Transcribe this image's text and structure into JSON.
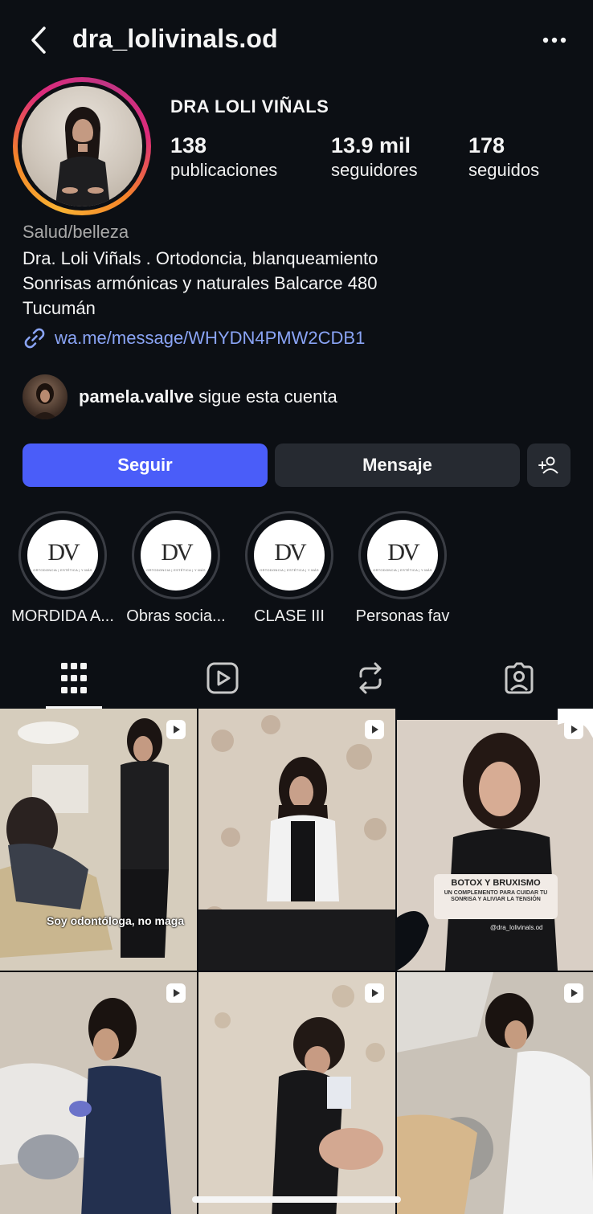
{
  "header": {
    "username": "dra_lolivinals.od",
    "back_icon": "chevron-left-icon",
    "more_icon": "more-horizontal-icon"
  },
  "profile": {
    "display_name": "DRA LOLI VIÑALS",
    "stats": [
      {
        "value": "138",
        "label": "publicaciones"
      },
      {
        "value": "13.9 mil",
        "label": "seguidores"
      },
      {
        "value": "178",
        "label": "seguidos"
      }
    ],
    "category": "Salud/belleza",
    "bio_lines": [
      "Dra. Loli Viñals . Ortodoncia, blanqueamiento",
      "Sonrisas armónicas y naturales Balcarce 480",
      "Tucumán"
    ],
    "link": "wa.me/message/WHYDN4PMW2CDB1"
  },
  "followed_by": {
    "user": "pamela.vallve",
    "text": "sigue esta cuenta"
  },
  "actions": {
    "follow": "Seguir",
    "message": "Mensaje",
    "add_user_icon": "add-user-icon"
  },
  "highlights": [
    {
      "label": "MORDIDA A...",
      "logo": "DV",
      "tag": "ORTODONCIA | ESTÉTICA | Y MÁS"
    },
    {
      "label": "Obras socia...",
      "logo": "DV",
      "tag": "ORTODONCIA | ESTÉTICA | Y MÁS"
    },
    {
      "label": "CLASE III",
      "logo": "DV",
      "tag": "ORTODONCIA | ESTÉTICA | Y MÁS"
    },
    {
      "label": "Personas fav",
      "logo": "DV",
      "tag": "ORTODONCIA | ESTÉTICA | Y MÁS"
    }
  ],
  "tabs": [
    "grid-icon",
    "reels-icon",
    "reposts-icon",
    "tagged-icon"
  ],
  "posts": [
    {
      "caption": "Soy odontóloga, no maga",
      "reel": true
    },
    {
      "caption": "",
      "reel": true
    },
    {
      "caption": "BOTOX Y BRUXISMO",
      "subcaption": "UN COMPLEMENTO PARA CUIDAR TU SONRISA Y ALIVIAR LA TENSIÓN",
      "handle": "@dra_lolivinals.od",
      "reel": true
    },
    {
      "caption": "",
      "reel": true
    },
    {
      "caption": "",
      "reel": true
    },
    {
      "caption": "",
      "reel": true
    }
  ],
  "colors": {
    "background": "#0c0f14",
    "follow_button": "#4a5df9",
    "secondary_button": "#262a31",
    "link": "#8aa4f5",
    "muted": "#a8a8a8"
  }
}
